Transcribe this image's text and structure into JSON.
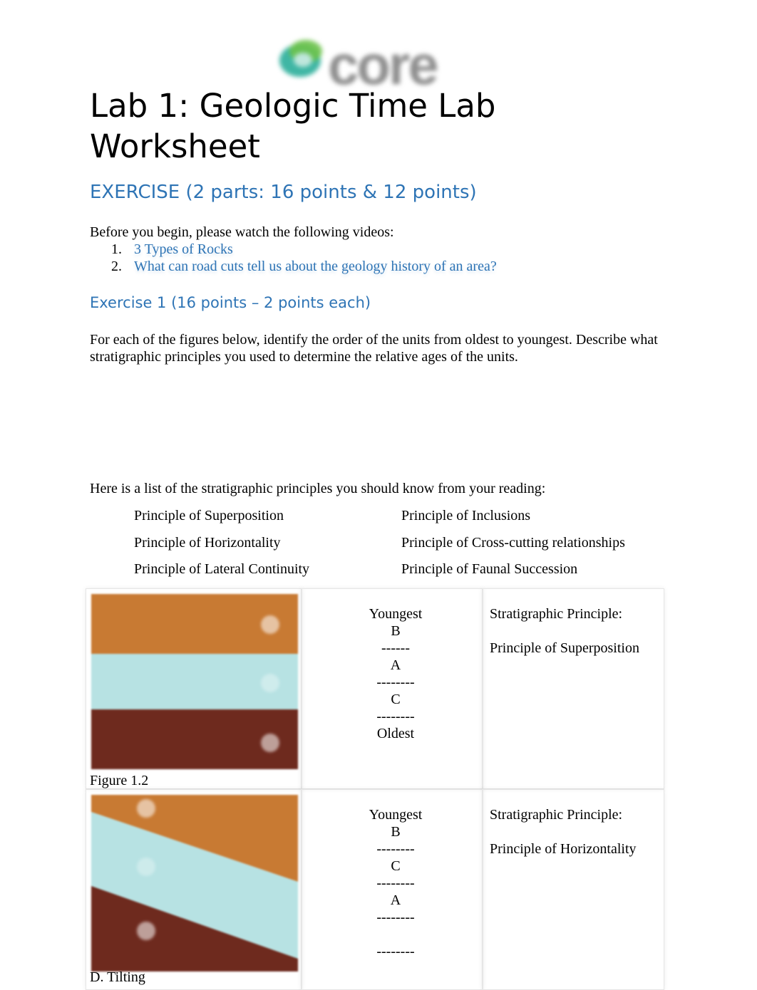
{
  "logo": {
    "text": "core",
    "icon": "core-logo-icon"
  },
  "document": {
    "title": "Lab 1: Geologic Time Lab Worksheet",
    "exercise_heading": "EXERCISE (2 parts:  16 points & 12 points)",
    "intro": "Before you begin, please watch the following videos:",
    "videos": [
      {
        "num": "1.",
        "label": "3 Types of Rocks"
      },
      {
        "num": "2.",
        "label": "What can road cuts tell us about the geology history of an area?"
      }
    ],
    "exercise1_heading": "Exercise 1 (16 points – 2 points each)",
    "instructions": "For each of the figures below, identify the order of the units from oldest to youngest. Describe what stratigraphic principles you used to determine the relative ages of the units.",
    "principles_intro": "Here is a list of the stratigraphic principles you should know from your reading:",
    "principles": [
      "Principle of Superposition",
      "Principle of Inclusions",
      "Principle of Horizontality",
      "Principle of Cross-cutting relationships",
      "Principle of Lateral Continuity",
      "Principle of Faunal Succession"
    ]
  },
  "figures": [
    {
      "caption": "Figure 1.2",
      "order_lines": [
        "Youngest",
        "B",
        "------",
        "A",
        "--------",
        "C",
        "--------",
        "Oldest"
      ],
      "principle_label": "Stratigraphic Principle:",
      "principle_answer": "Principle of Superposition",
      "colors": {
        "top": "#c87a33",
        "middle": "#b7e2e3",
        "bottom": "#6e2a1e"
      }
    },
    {
      "caption": "D.  Tilting",
      "order_lines": [
        "Youngest",
        "B",
        "--------",
        "C",
        "--------",
        "A",
        "--------",
        "",
        "--------"
      ],
      "principle_label": "Stratigraphic Principle:",
      "principle_answer": "Principle of Horizontality",
      "colors": {
        "top": "#c87a33",
        "middle": "#b7e2e3",
        "bottom": "#6e2a1e"
      }
    }
  ]
}
